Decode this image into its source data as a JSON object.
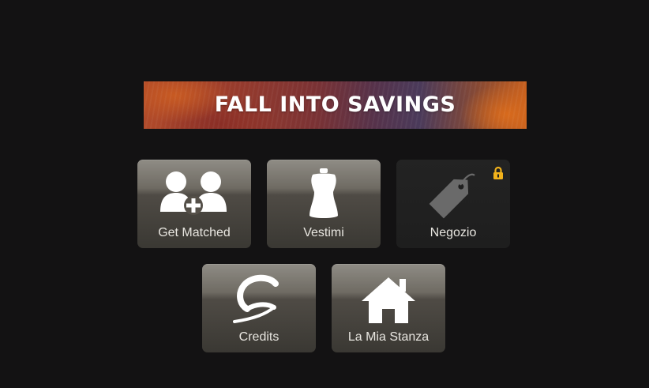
{
  "banner": {
    "text": "FALL INTO SAVINGS"
  },
  "tiles": [
    {
      "label": "Get Matched",
      "icon": "add-users-icon",
      "locked": false
    },
    {
      "label": "Vestimi",
      "icon": "dress-form-icon",
      "locked": false
    },
    {
      "label": "Negozio",
      "icon": "price-tag-icon",
      "locked": true
    },
    {
      "label": "Credits",
      "icon": "credits-logo-icon",
      "locked": false
    },
    {
      "label": "La Mia Stanza",
      "icon": "house-icon",
      "locked": false
    }
  ],
  "colors": {
    "background": "#131213",
    "lock": "#f2b21b",
    "tile_label": "#e8e6e0"
  }
}
